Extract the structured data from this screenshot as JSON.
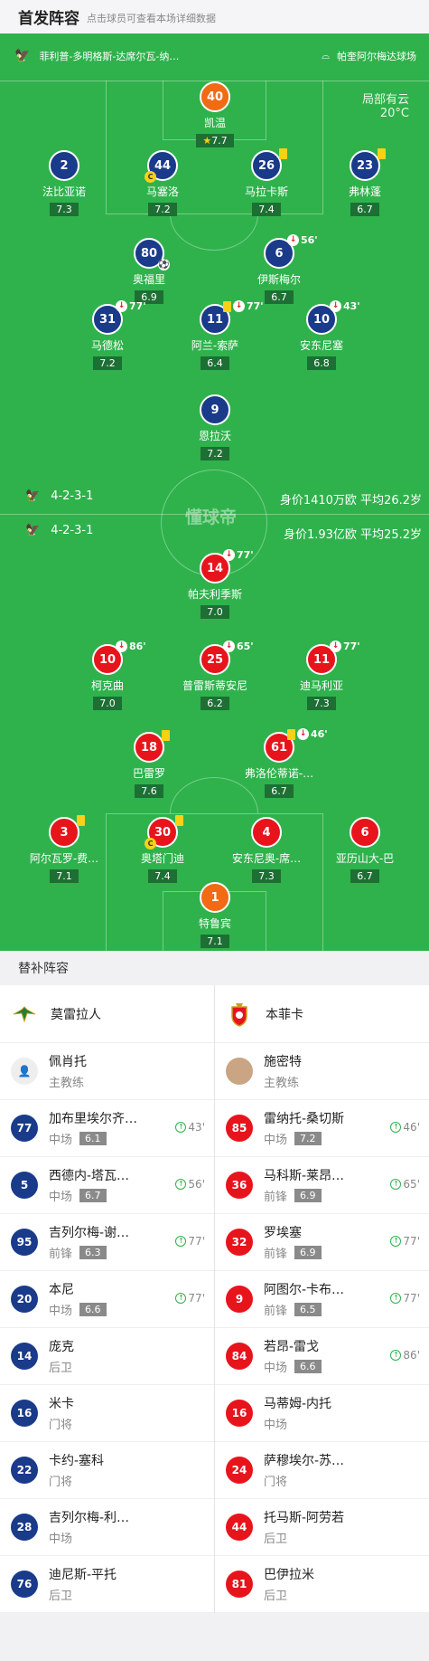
{
  "header": {
    "title": "首发阵容",
    "subtitle": "点击球员可查看本场详细数据"
  },
  "pitch": {
    "away_team": "菲利普-多明格斯-达席尔瓦-纳…",
    "venue": "帕奎阿尔梅达球场",
    "weather": "局部有云",
    "temperature": "20°C",
    "watermark": "懂球帝",
    "away_formation": "4-2-3-1",
    "away_value": "身价1410万欧 平均26.2岁",
    "home_formation": "4-2-3-1",
    "home_value": "身价1.93亿欧 平均25.2岁"
  },
  "away_players": [
    {
      "num": "40",
      "name": "凯温",
      "rating": "7.7",
      "star": "★"
    },
    {
      "num": "2",
      "name": "法比亚诺",
      "rating": "7.3"
    },
    {
      "num": "44",
      "name": "马塞洛",
      "rating": "7.2",
      "cap": "C"
    },
    {
      "num": "26",
      "name": "马拉卡斯",
      "rating": "7.4"
    },
    {
      "num": "23",
      "name": "弗林蓬",
      "rating": "6.7"
    },
    {
      "num": "80",
      "name": "奥福里",
      "rating": "6.9"
    },
    {
      "num": "6",
      "name": "伊斯梅尔",
      "rating": "6.7",
      "sub": "56'"
    },
    {
      "num": "31",
      "name": "马德松",
      "rating": "7.2",
      "sub": "77'"
    },
    {
      "num": "11",
      "name": "阿兰-索萨",
      "rating": "6.4",
      "sub": "77'"
    },
    {
      "num": "10",
      "name": "安东尼塞",
      "rating": "6.8",
      "sub": "43'"
    },
    {
      "num": "9",
      "name": "恩拉沃",
      "rating": "7.2"
    }
  ],
  "home_players": [
    {
      "num": "14",
      "name": "帕夫利季斯",
      "rating": "7.0",
      "sub": "77'"
    },
    {
      "num": "10",
      "name": "柯克曲",
      "rating": "7.0",
      "sub": "86'"
    },
    {
      "num": "25",
      "name": "普雷斯蒂安尼",
      "rating": "6.2",
      "sub": "65'"
    },
    {
      "num": "11",
      "name": "迪马利亚",
      "rating": "7.3",
      "sub": "77'"
    },
    {
      "num": "18",
      "name": "巴雷罗",
      "rating": "7.6"
    },
    {
      "num": "61",
      "name": "弗洛伦蒂诺-…",
      "rating": "6.7",
      "sub": "46'"
    },
    {
      "num": "3",
      "name": "阿尔瓦罗-费…",
      "rating": "7.1"
    },
    {
      "num": "30",
      "name": "奥塔门迪",
      "rating": "7.4",
      "cap": "C"
    },
    {
      "num": "4",
      "name": "安东尼奥-席…",
      "rating": "7.3"
    },
    {
      "num": "6",
      "name": "亚历山大-巴",
      "rating": "6.7"
    },
    {
      "num": "1",
      "name": "特鲁宾",
      "rating": "7.1"
    }
  ],
  "subs_section": {
    "title": "替补阵容"
  },
  "left": {
    "team": "莫雷拉人",
    "coach": {
      "name": "佩肖托",
      "role": "主教练"
    },
    "rows": [
      {
        "num": "77",
        "name": "加布里埃尔齐…",
        "pos": "中场",
        "rating": "6.1",
        "min": "43'"
      },
      {
        "num": "5",
        "name": "西德内-塔瓦…",
        "pos": "中场",
        "rating": "6.7",
        "min": "56'"
      },
      {
        "num": "95",
        "name": "吉列尔梅-谢…",
        "pos": "前锋",
        "rating": "6.3",
        "min": "77'"
      },
      {
        "num": "20",
        "name": "本尼",
        "pos": "中场",
        "rating": "6.6",
        "min": "77'"
      },
      {
        "num": "14",
        "name": "庞克",
        "pos": "后卫"
      },
      {
        "num": "16",
        "name": "米卡",
        "pos": "门将"
      },
      {
        "num": "22",
        "name": "卡约-塞科",
        "pos": "门将"
      },
      {
        "num": "28",
        "name": "吉列尔梅-利…",
        "pos": "中场"
      },
      {
        "num": "76",
        "name": "迪尼斯-平托",
        "pos": "后卫"
      }
    ]
  },
  "right": {
    "team": "本菲卡",
    "coach": {
      "name": "施密特",
      "role": "主教练"
    },
    "rows": [
      {
        "num": "85",
        "name": "雷纳托-桑切斯",
        "pos": "中场",
        "rating": "7.2",
        "min": "46'"
      },
      {
        "num": "36",
        "name": "马科斯-莱昂…",
        "pos": "前锋",
        "rating": "6.9",
        "min": "65'"
      },
      {
        "num": "32",
        "name": "罗埃塞",
        "pos": "前锋",
        "rating": "6.9",
        "min": "77'"
      },
      {
        "num": "9",
        "name": "阿图尔-卡布…",
        "pos": "前锋",
        "rating": "6.5",
        "min": "77'"
      },
      {
        "num": "84",
        "name": "若昂-雷戈",
        "pos": "中场",
        "rating": "6.6",
        "min": "86'"
      },
      {
        "num": "16",
        "name": "马蒂姆-内托",
        "pos": "中场"
      },
      {
        "num": "24",
        "name": "萨穆埃尔-苏…",
        "pos": "门将"
      },
      {
        "num": "44",
        "name": "托马斯-阿劳若",
        "pos": "后卫"
      },
      {
        "num": "81",
        "name": "巴伊拉米",
        "pos": "后卫"
      }
    ]
  }
}
